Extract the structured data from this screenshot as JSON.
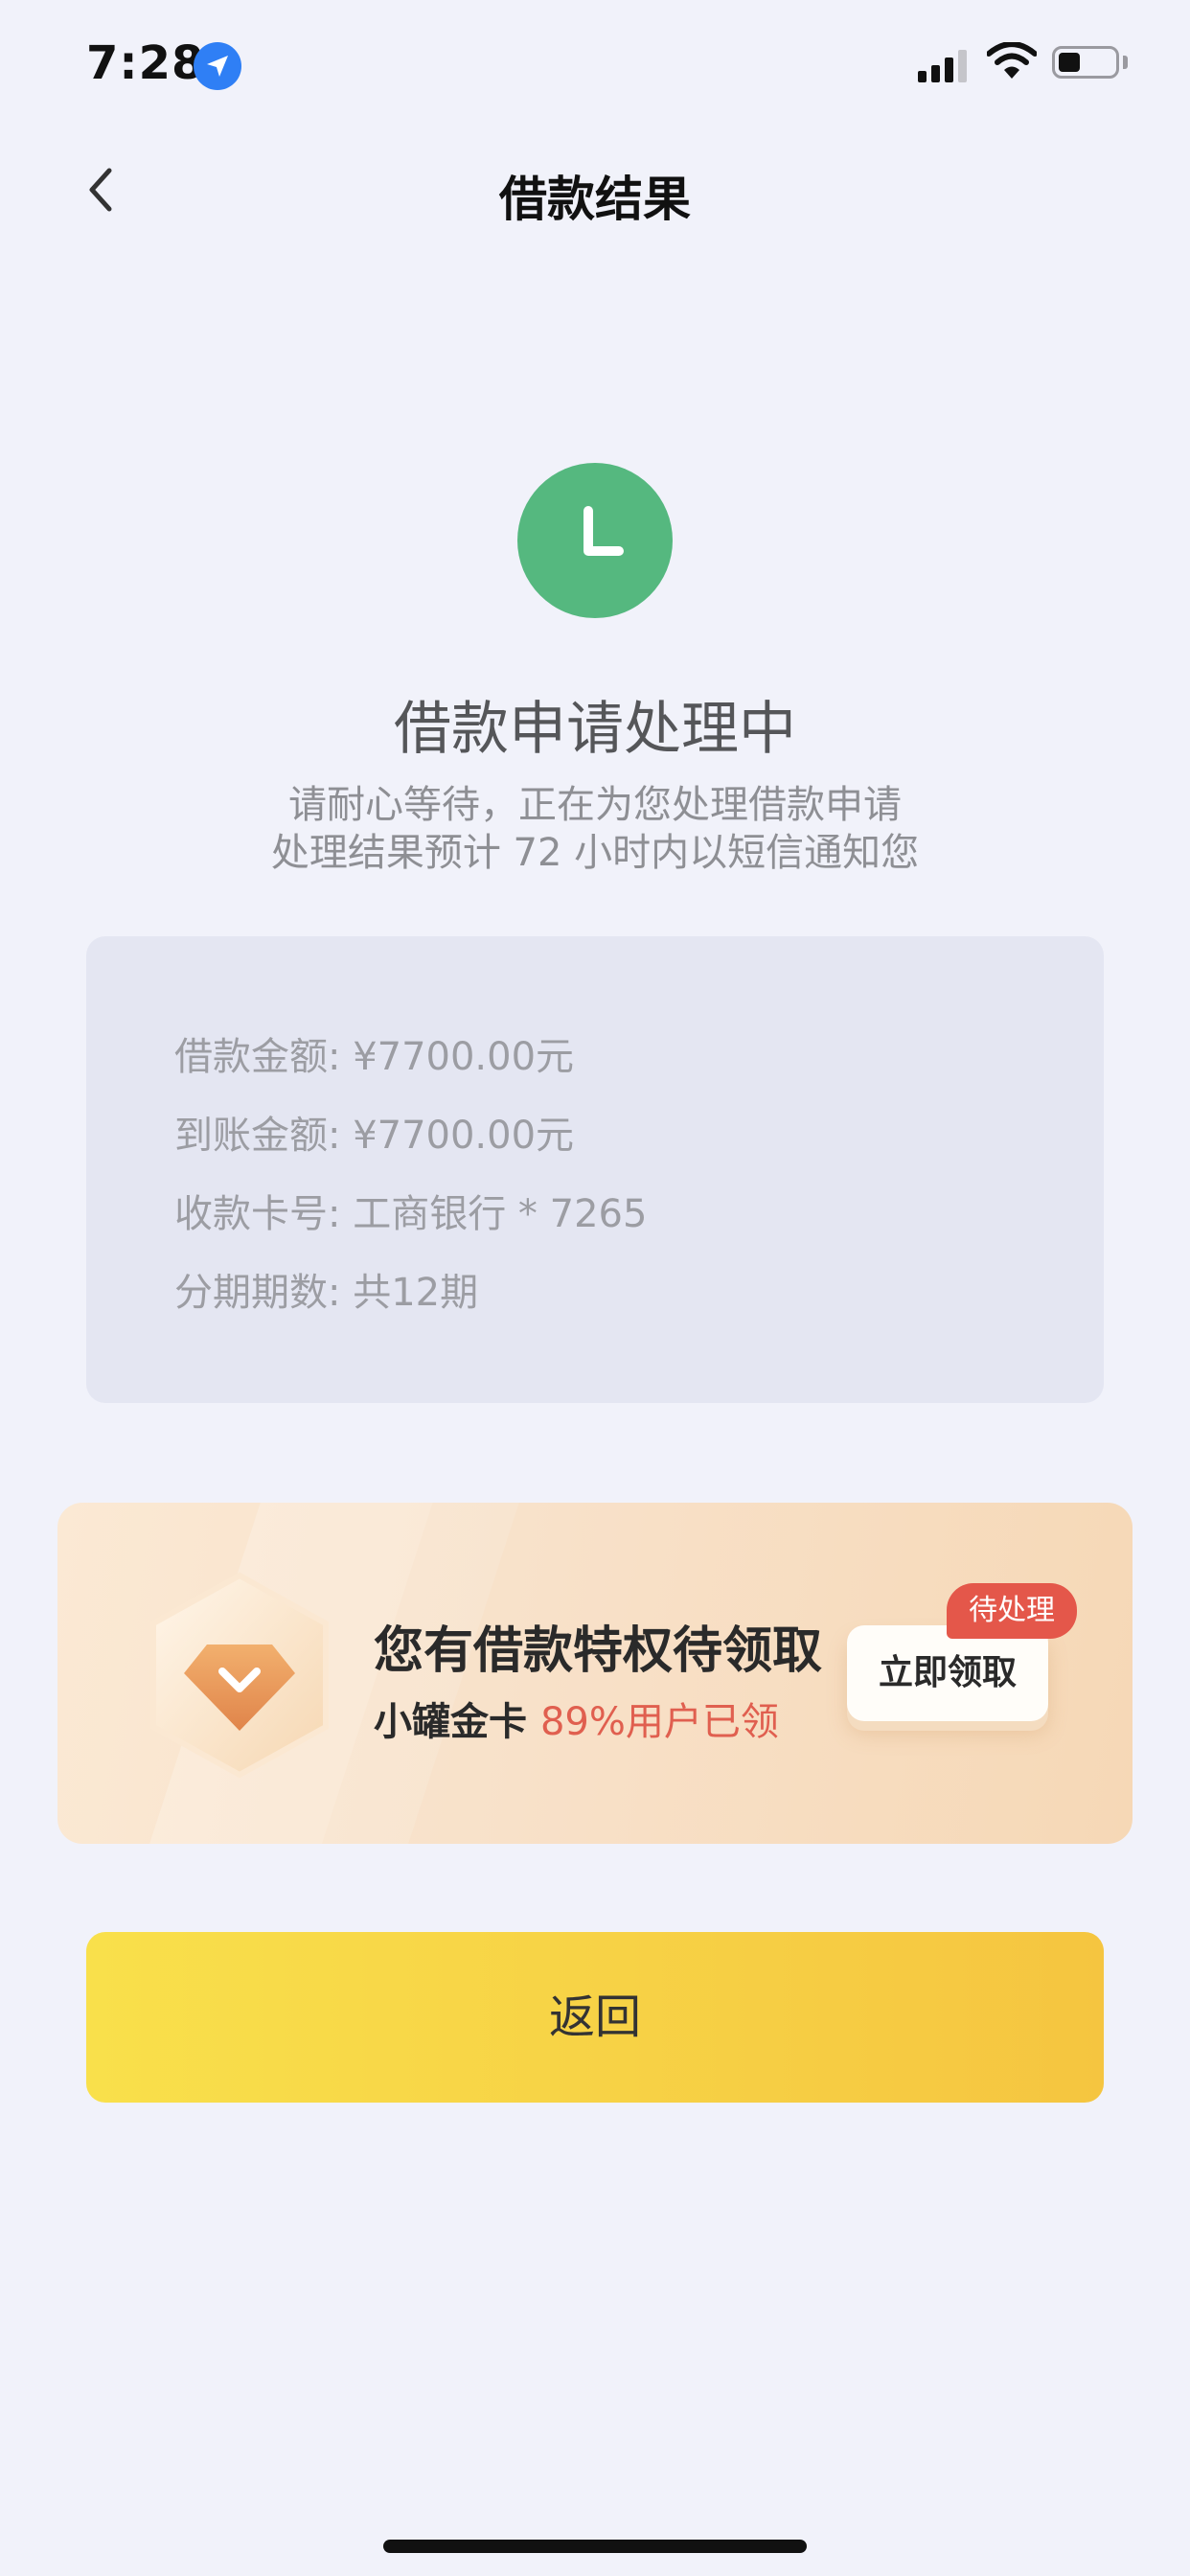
{
  "status_bar": {
    "time": "7:28"
  },
  "nav": {
    "title": "借款结果"
  },
  "result": {
    "title": "借款申请处理中",
    "description_lines": [
      "请耐心等待，正在为您处理借款申请",
      "处理结果预计 72 小时内以短信通知您"
    ]
  },
  "details": [
    {
      "label": "借款金额",
      "value": "¥7700.00元"
    },
    {
      "label": "到账金额",
      "value": "¥7700.00元"
    },
    {
      "label": "收款卡号",
      "value": "工商银行 * 7265"
    },
    {
      "label": "分期期数",
      "value": "共12期"
    }
  ],
  "details_text": [
    "借款金额: ¥7700.00元",
    "到账金额: ¥7700.00元",
    "收款卡号: 工商银行 * 7265",
    "分期期数: 共12期"
  ],
  "promo": {
    "title": "您有借款特权待领取",
    "subtitle_prefix": "小罐金卡",
    "subtitle_highlight": "89%用户已领",
    "button_label": "立即领取",
    "tag": "待处理",
    "icon": "diamond-gem-icon"
  },
  "return_button": {
    "label": "返回"
  },
  "colors": {
    "background": "#f1f2fa",
    "pending_green": "#55b87f",
    "highlight_red": "#e05f4f",
    "button_yellow_start": "#f9e04b",
    "button_yellow_end": "#f5c540",
    "location_blue": "#2f7ff5"
  },
  "icons": {
    "location": "location-arrow-icon",
    "signal": "cellular-signal-icon",
    "wifi": "wifi-icon",
    "battery": "battery-icon",
    "back": "chevron-left-icon",
    "pending": "clock-pending-icon"
  }
}
